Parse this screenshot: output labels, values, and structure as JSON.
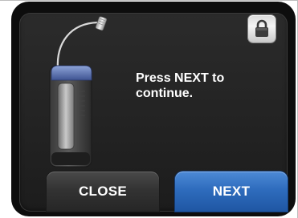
{
  "screen": {
    "message": "Press NEXT to\ncontinue.",
    "lock_icon": "lock-icon",
    "device_icon": "insulin-pump-device"
  },
  "buttons": {
    "close_label": "CLOSE",
    "next_label": "NEXT"
  },
  "colors": {
    "background": "#0d0d0d",
    "panel": "#262626",
    "next_button": "#2e6cbd",
    "close_button": "#333333",
    "text": "#ffffff"
  }
}
